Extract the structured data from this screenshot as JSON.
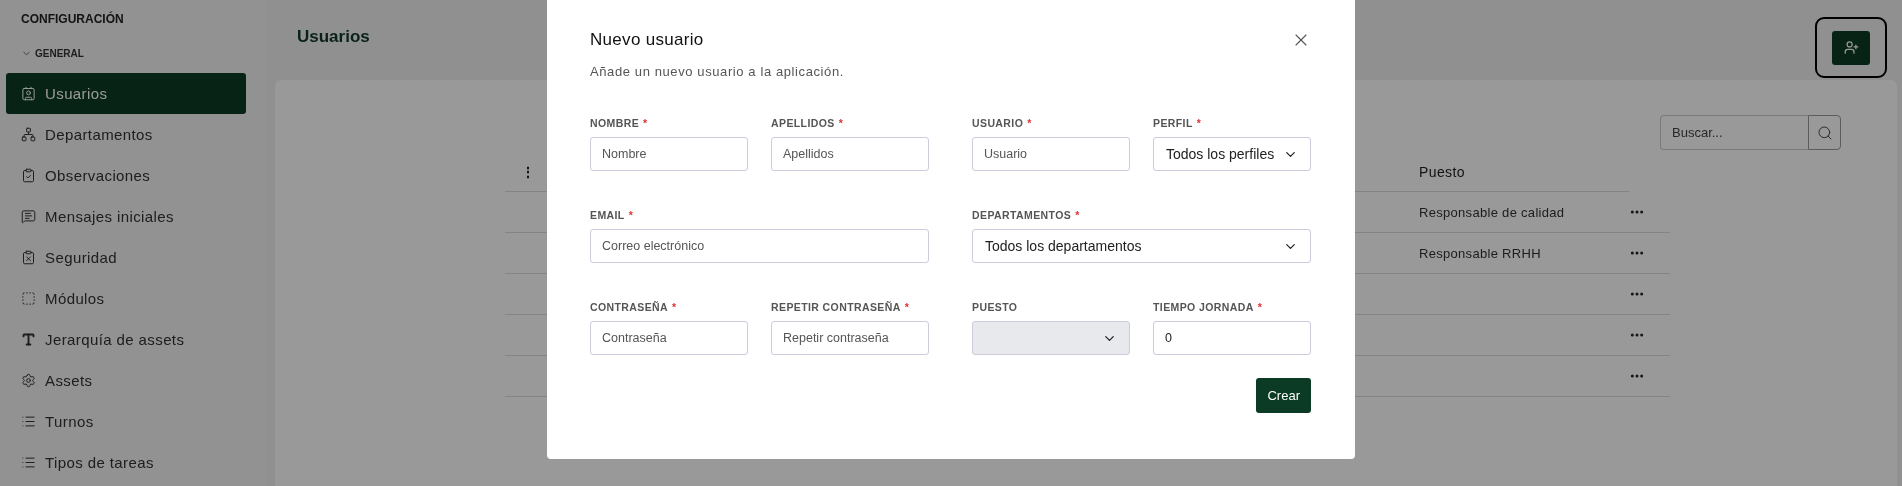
{
  "sidebar": {
    "title": "CONFIGURACIÓN",
    "group": {
      "label": "GENERAL",
      "expanded": true
    },
    "items": [
      {
        "label": "Usuarios",
        "kind": "users",
        "selected": true
      },
      {
        "label": "Departamentos",
        "kind": "network",
        "selected": false
      },
      {
        "label": "Observaciones",
        "kind": "clipboard-check",
        "selected": false
      },
      {
        "label": "Mensajes iniciales",
        "kind": "message",
        "selected": false
      },
      {
        "label": "Seguridad",
        "kind": "clipboard-x",
        "selected": false
      },
      {
        "label": "Módulos",
        "kind": "frame",
        "selected": false
      },
      {
        "label": "Jerarquía de assets",
        "kind": "type",
        "selected": false
      },
      {
        "label": "Assets",
        "kind": "gear",
        "selected": false
      },
      {
        "label": "Turnos",
        "kind": "list",
        "selected": false
      },
      {
        "label": "Tipos de tareas",
        "kind": "list",
        "selected": false
      }
    ]
  },
  "header": {
    "title": "Usuarios"
  },
  "search": {
    "placeholder": "Buscar..."
  },
  "table": {
    "column_menu": "⋮",
    "columns": [
      "Puesto"
    ],
    "rows": [
      {
        "puesto": "Responsable de calidad"
      },
      {
        "puesto": "Responsable RRHH"
      },
      {},
      {},
      {}
    ]
  },
  "modal": {
    "title": "Nuevo usuario",
    "subtitle": "Añade un nuevo usuario a la aplicación.",
    "rows": [
      {
        "left": [
          {
            "label": "NOMBRE",
            "mark": "*",
            "kind": "input",
            "placeholder": "Nombre"
          },
          {
            "label": "APELLIDOS",
            "mark": "*",
            "kind": "input",
            "placeholder": "Apellidos"
          }
        ],
        "right": [
          {
            "label": "USUARIO",
            "mark": "*",
            "kind": "input",
            "placeholder": "Usuario"
          },
          {
            "label": "PERFIL",
            "mark": "*",
            "kind": "select",
            "value": "Todos los perfiles",
            "disabled": false
          }
        ]
      },
      {
        "left": [
          {
            "label": "EMAIL",
            "mark": "*",
            "kind": "input",
            "placeholder": "Correo electrónico"
          }
        ],
        "right": [
          {
            "label": "DEPARTAMENTOS",
            "mark": "*",
            "kind": "select",
            "value": "Todos los departamentos",
            "disabled": false
          }
        ]
      },
      {
        "left": [
          {
            "label": "CONTRASEÑA",
            "mark": "*",
            "kind": "input",
            "placeholder": "Contraseña"
          },
          {
            "label": "REPETIR CONTRASEÑA",
            "mark": "*",
            "kind": "input",
            "placeholder": "Repetir contraseña"
          }
        ],
        "right": [
          {
            "label": "PUESTO",
            "kind": "select",
            "disabled": true
          },
          {
            "label": "TIEMPO JORNADA",
            "mark": "*",
            "kind": "input",
            "value": "0"
          }
        ]
      }
    ],
    "submit": "Crear"
  }
}
